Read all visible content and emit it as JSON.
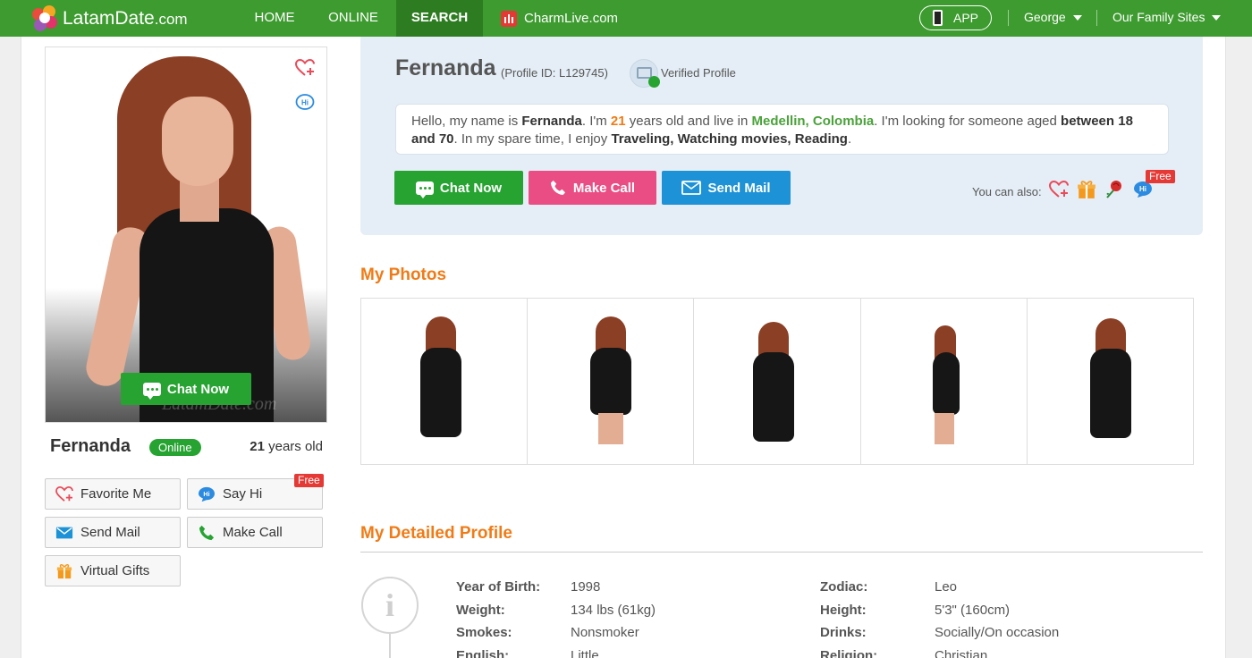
{
  "nav": {
    "logo_main": "LatamDate",
    "logo_suffix": ".com",
    "home": "HOME",
    "online": "ONLINE",
    "search": "SEARCH",
    "charmlive": "CharmLive.com",
    "app": "APP",
    "user": "George",
    "family_sites": "Our Family Sites"
  },
  "sidebar": {
    "watermark": "LatamDate.com",
    "chat_now": "Chat Now",
    "name": "Fernanda",
    "online_badge": "Online",
    "age_number": "21",
    "age_suffix": " years old",
    "buttons": {
      "favorite": "Favorite Me",
      "say_hi": "Say Hi",
      "send_mail": "Send Mail",
      "make_call": "Make Call",
      "virtual_gifts": "Virtual Gifts"
    },
    "free_tag": "Free"
  },
  "profile": {
    "name": "Fernanda",
    "profile_id": "(Profile ID: L129745)",
    "verified": "Verified Profile",
    "intro": {
      "p1": "Hello, my name is ",
      "name": "Fernanda",
      "p2": ". I'm ",
      "age": "21",
      "p3": " years old and live in ",
      "location": "Medellin, Colombia",
      "p4": ". I'm looking for someone aged ",
      "age_range": "between 18 and 70",
      "p5": ". In my spare time, I enjoy ",
      "hobbies": "Traveling, Watching movies, Reading",
      "p6": "."
    },
    "chat_now": "Chat Now",
    "make_call": "Make Call",
    "send_mail": "Send Mail",
    "you_can_also": "You can also:",
    "free_tag": "Free"
  },
  "photos": {
    "title": "My Photos",
    "count": 5
  },
  "details": {
    "title": "My Detailed Profile",
    "left": [
      {
        "label": "Year of Birth:",
        "value": "1998"
      },
      {
        "label": "Weight:",
        "value": "134 lbs (61kg)"
      },
      {
        "label": "Smokes:",
        "value": "Nonsmoker"
      },
      {
        "label": "English:",
        "value": "Little"
      }
    ],
    "right": [
      {
        "label": "Zodiac:",
        "value": "Leo"
      },
      {
        "label": "Height:",
        "value": "5'3\" (160cm)"
      },
      {
        "label": "Drinks:",
        "value": "Socially/On occasion"
      },
      {
        "label": "Religion:",
        "value": "Christian"
      }
    ]
  },
  "colors": {
    "nav_green": "#3d9b2f",
    "accent_orange": "#f07b16",
    "chat_green": "#26a331",
    "call_pink": "#e94d83",
    "mail_blue": "#1e92d6"
  }
}
